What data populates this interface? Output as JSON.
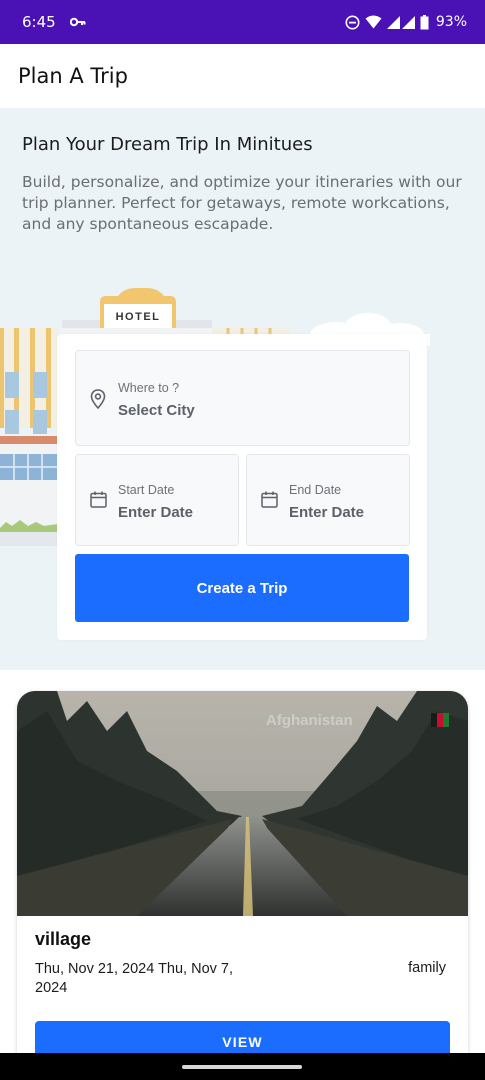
{
  "status_bar": {
    "time": "6:45",
    "battery": "93%",
    "icons": [
      "key-icon",
      "dnd-icon",
      "wifi-icon",
      "signal-icon",
      "battery-icon"
    ]
  },
  "app_bar": {
    "title": "Plan A Trip"
  },
  "hero": {
    "title": "Plan Your Dream Trip In Minitues",
    "description": "Build, personalize, and optimize your itineraries with our trip planner. Perfect for getaways, remote workcations, and any spontaneous escapade.",
    "hotel_sign": "HOTEL"
  },
  "form": {
    "city": {
      "label": "Where to ?",
      "value": "Select City"
    },
    "start_date": {
      "label": "Start Date",
      "value": "Enter Date"
    },
    "end_date": {
      "label": "End Date",
      "value": "Enter Date"
    },
    "create_label": "Create a Trip"
  },
  "trip": {
    "country": "Afghanistan",
    "name": "village",
    "dates": "Thu, Nov 21, 2024 Thu, Nov 7, 2024",
    "type": "family",
    "view_label": "VIEW"
  },
  "colors": {
    "status_bar": "#4a12b5",
    "hero_bg": "#ebf3f7",
    "accent": "#1a6dff"
  }
}
